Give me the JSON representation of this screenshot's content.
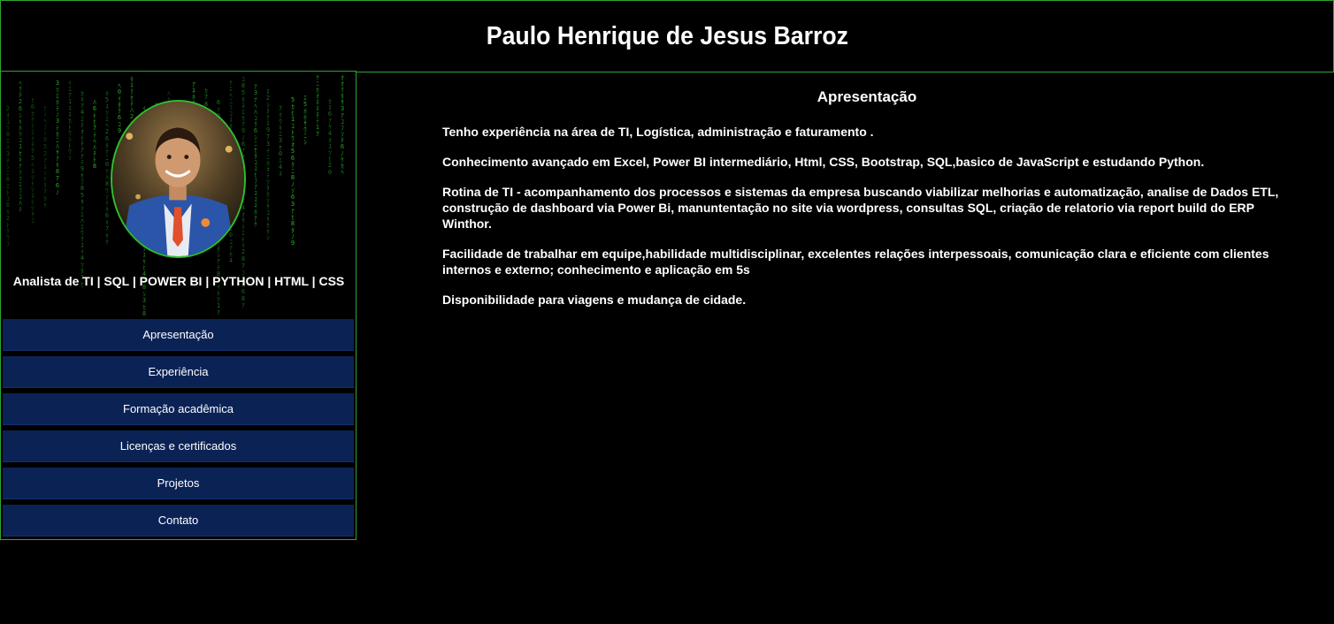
{
  "header": {
    "name": "Paulo Henrique de Jesus Barroz"
  },
  "sidebar": {
    "role": "Analista de TI | SQL | POWER BI | PYTHON | HTML | CSS",
    "nav": [
      {
        "label": "Apresentação"
      },
      {
        "label": "Experiência"
      },
      {
        "label": "Formação acadêmica"
      },
      {
        "label": "Licenças e certificados"
      },
      {
        "label": "Projetos"
      },
      {
        "label": "Contato"
      }
    ]
  },
  "main": {
    "title": "Apresentação",
    "paragraphs": [
      "Tenho experiência na área de TI, Logística, administração e faturamento .",
      "Conhecimento avançado em Excel, Power BI intermediário, Html, CSS, Bootstrap, SQL,basico de JavaScript e estudando Python.",
      "Rotina de TI - acompanhamento dos processos e sistemas da empresa buscando viabilizar melhorias e automatização, analise de Dados ETL, construção de dashboard via Power Bi, manuntentação no site via wordpress, consultas SQL, criação de relatorio via report build do ERP Winthor.",
      "Facilidade de trabalhar em equipe,habilidade multidisciplinar, excelentes relações interpessoais, comunicação clara e eficiente com clientes internos e externo; conhecimento e aplicação em 5s",
      "Disponibilidade para viagens e mudança de cidade."
    ]
  },
  "colors": {
    "background": "#000000",
    "border_green": "#2fa52f",
    "nav_blue": "#0b2255",
    "matrix_green": "#2fbf2f"
  }
}
